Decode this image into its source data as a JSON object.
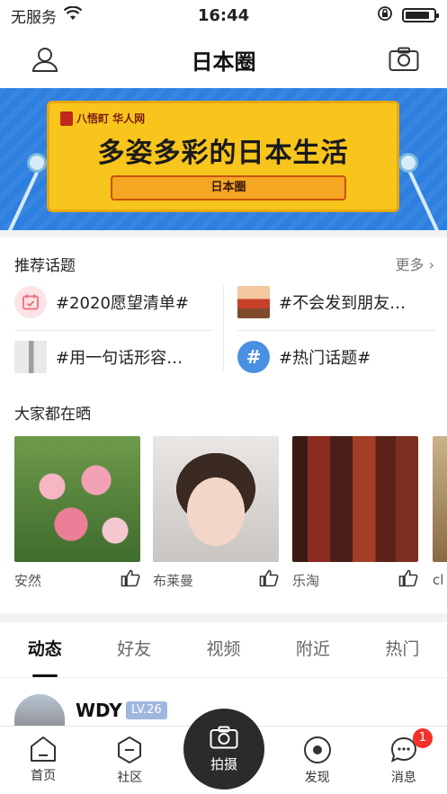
{
  "status_bar": {
    "carrier": "无服务",
    "time": "16:44",
    "battery_level": 0.85
  },
  "nav": {
    "title": "日本圈"
  },
  "banner": {
    "logo_text": "八悟町 华人网",
    "headline": "多姿多彩的日本生活",
    "pill": "日本圈"
  },
  "topics_section": {
    "title": "推荐话题",
    "more": "更多 ›",
    "topics": [
      {
        "label": "#2020愿望清单#",
        "icon": "calendar-icon"
      },
      {
        "label": "#不会发到朋友…",
        "icon": "landscape-thumbnail"
      },
      {
        "label": "#用一句话形容…",
        "icon": "person-thumbnail"
      },
      {
        "label": "#热门话题#",
        "icon": "hashtag-icon"
      }
    ]
  },
  "showcase": {
    "title": "大家都在晒",
    "cards": [
      {
        "name": "安然",
        "photo": "flowers-photo"
      },
      {
        "name": "布莱曼",
        "photo": "doll-photo"
      },
      {
        "name": "乐淘",
        "photo": "bottles-photo"
      },
      {
        "name": "cl",
        "photo": "partial-photo"
      }
    ]
  },
  "tabs": [
    {
      "label": "动态",
      "active": true
    },
    {
      "label": "好友",
      "active": false
    },
    {
      "label": "视频",
      "active": false
    },
    {
      "label": "附近",
      "active": false
    },
    {
      "label": "热门",
      "active": false
    }
  ],
  "feed": {
    "user_name": "WDY",
    "level": "LV.26"
  },
  "tabbar": {
    "items": [
      {
        "label": "首页",
        "icon": "home-icon"
      },
      {
        "label": "社区",
        "icon": "community-icon"
      },
      {
        "label": "发现",
        "icon": "discover-icon"
      },
      {
        "label": "消息",
        "icon": "message-icon",
        "badge": "1"
      }
    ],
    "center": {
      "label": "拍摄",
      "icon": "camera-icon"
    }
  },
  "colors": {
    "banner_blue": "#2d7fe0",
    "banner_yellow": "#f8c51c",
    "badge_red": "#f3322c",
    "level_badge": "#9fb6df"
  }
}
